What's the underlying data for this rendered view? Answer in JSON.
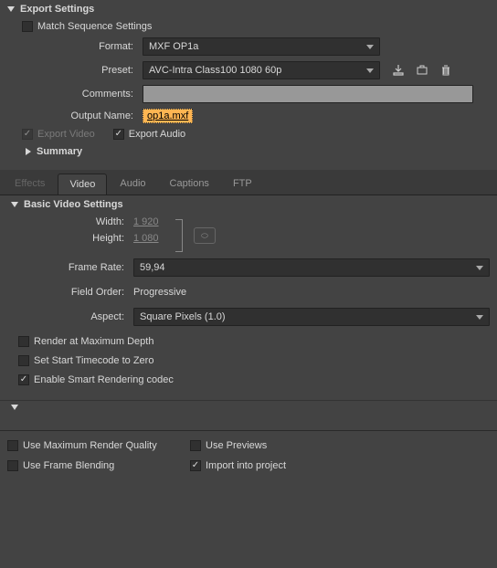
{
  "exportSettings": {
    "title": "Export Settings",
    "matchSequence": "Match Sequence Settings",
    "formatLabel": "Format:",
    "formatValue": "MXF OP1a",
    "presetLabel": "Preset:",
    "presetValue": "AVC-Intra Class100 1080 60p",
    "commentsLabel": "Comments:",
    "outputNameLabel": "Output Name:",
    "outputNameValue": "op1a.mxf",
    "exportVideo": "Export Video",
    "exportAudio": "Export Audio",
    "summary": "Summary"
  },
  "tabs": {
    "effects": "Effects",
    "video": "Video",
    "audio": "Audio",
    "captions": "Captions",
    "ftp": "FTP"
  },
  "videoSettings": {
    "title": "Basic Video Settings",
    "widthLabel": "Width:",
    "widthValue": "1 920",
    "heightLabel": "Height:",
    "heightValue": "1 080",
    "frameRateLabel": "Frame Rate:",
    "frameRateValue": "59,94",
    "fieldOrderLabel": "Field Order:",
    "fieldOrderValue": "Progressive",
    "aspectLabel": "Aspect:",
    "aspectValue": "Square Pixels (1.0)",
    "renderMaxDepth": "Render at Maximum Depth",
    "setStartTimecode": "Set Start Timecode to Zero",
    "enableSmart": "Enable Smart Rendering codec"
  },
  "bottom": {
    "maxQuality": "Use Maximum Render Quality",
    "previews": "Use Previews",
    "frameBlending": "Use Frame Blending",
    "importProject": "Import into project"
  }
}
